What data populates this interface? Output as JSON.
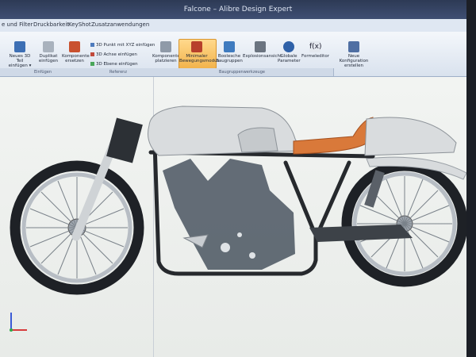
{
  "window": {
    "title": "Falcone – Alibre Design Expert"
  },
  "menu": [
    "e und Filter",
    "Druckbarkeit",
    "KeyShot",
    "Zusatzanwendungen"
  ],
  "ribbon": {
    "einfuegen": {
      "new_part": "Neues 3D Teil einfügen ▾",
      "duplicate": "Duplikat einfügen",
      "components": "Komponente ersetzen"
    },
    "referenz": {
      "point": "3D Punkt mit XYZ einfügen",
      "axis": "3D Achse einfügen",
      "plane": "3D Ebene einfügen"
    },
    "baugruppe": {
      "place": "Komponente platzieren",
      "minimal": "Minimaler Bewegungsmodus",
      "boolean": "Boolesche Baugruppen",
      "explode": "Explosionsansicht",
      "global": "Globale Parameter",
      "formula": "Formeleditor"
    },
    "konfig": {
      "new": "Neue Konfiguration erstellen"
    },
    "groups": [
      "Einfügen",
      "Referenz",
      "Baugruppenwerkzeuge"
    ]
  },
  "colors": {
    "accent": "#f2b34c",
    "seat": "#d9793a",
    "frame": "#2a2d31",
    "engine": "#3e4750"
  }
}
